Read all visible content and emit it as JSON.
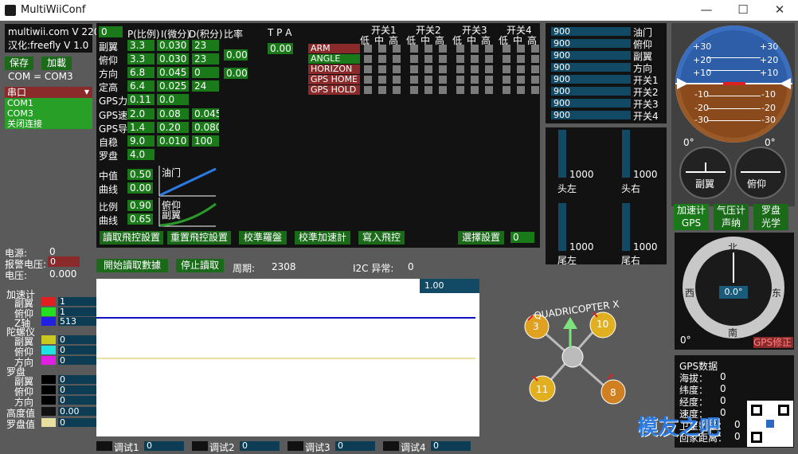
{
  "window": {
    "title": "MultiWiiConf",
    "min": "—",
    "max": "☐",
    "close": "✕"
  },
  "info": {
    "line1": "multiwii.com V 220",
    "line2": "汉化:freefly V 1.0"
  },
  "buttons": {
    "save": "保存",
    "load": "加載",
    "com_status": "COM = COM3",
    "read_pid": "讀取飛控設置",
    "reset_pid": "重置飛控設置",
    "calib_mag": "校準羅盤",
    "calib_acc": "校準加速計",
    "write": "寫入飛控",
    "select": "選擇設置",
    "select_val": "0",
    "start_read": "開始讀取數據",
    "stop_read": "停止讀取"
  },
  "serial": {
    "header": "串口",
    "items": [
      "COM1",
      "COM3",
      "关闭连接"
    ]
  },
  "pid": {
    "col0": "0",
    "header": [
      "P(比例)",
      "I(微分)",
      "D(积分)",
      "比率",
      "T P A"
    ],
    "rows": [
      {
        "name": "副翼",
        "p": "3.3",
        "i": "0.030",
        "d": "23"
      },
      {
        "name": "俯仰",
        "p": "3.3",
        "i": "0.030",
        "d": "23"
      },
      {
        "name": "方向",
        "p": "6.8",
        "i": "0.045",
        "d": "0"
      },
      {
        "name": "定高",
        "p": "6.4",
        "i": "0.025",
        "d": "24"
      },
      {
        "name": "GPS力",
        "p": "0.11",
        "i": "0.0",
        "d": ""
      },
      {
        "name": "GPS速",
        "p": "2.0",
        "i": "0.08",
        "d": "0.045"
      },
      {
        "name": "GPS导",
        "p": "1.4",
        "i": "0.20",
        "d": "0.080"
      },
      {
        "name": "自稳",
        "p": "9.0",
        "i": "0.010",
        "d": "100"
      },
      {
        "name": "罗盘",
        "p": "4.0",
        "i": "",
        "d": ""
      }
    ],
    "rate1": "0.00",
    "rate2": "0.00",
    "tpa": "0.00",
    "mid_label": "中值",
    "mid": "0.50",
    "curve_label": "曲线",
    "curve": "0.00",
    "throttle": "油门",
    "ratio_label": "比例",
    "ratio": "0.90",
    "curve2_label": "曲线",
    "curve2": "0.65",
    "pitchroll": "俯仰",
    "roll": "副翼"
  },
  "switches": {
    "groups": [
      "开关1",
      "开关2",
      "开关3",
      "开关4"
    ],
    "levels": [
      "低",
      "中",
      "高"
    ],
    "modes": [
      "ARM",
      "ANGLE",
      "HORIZON",
      "GPS HOME",
      "GPS HOLD"
    ]
  },
  "rc": {
    "items": [
      {
        "v": "900",
        "n": "油门"
      },
      {
        "v": "900",
        "n": "俯仰"
      },
      {
        "v": "900",
        "n": "副翼"
      },
      {
        "v": "900",
        "n": "方向"
      },
      {
        "v": "900",
        "n": "开关1"
      },
      {
        "v": "900",
        "n": "开关2"
      },
      {
        "v": "900",
        "n": "开关3"
      },
      {
        "v": "900",
        "n": "开关4"
      }
    ]
  },
  "motors": {
    "fl": "1000",
    "fr": "1000",
    "rl": "1000",
    "rr": "1000",
    "fl_n": "头左",
    "fr_n": "头右",
    "rl_n": "尾左",
    "rr_n": "尾右"
  },
  "horizon": {
    "ticks": [
      "+30",
      "+20",
      "+10",
      "-10",
      "-20",
      "-30"
    ],
    "deg_l": "0°",
    "deg_r": "0°",
    "roll": "副翼",
    "pitch": "俯仰"
  },
  "sensors": {
    "acc": "加速计",
    "baro": "气压计",
    "mag": "罗盘",
    "gps": "GPS",
    "sonar": "声纳",
    "opt": "光学"
  },
  "compass": {
    "n": "北",
    "s": "南",
    "w": "西",
    "e": "东",
    "val": "0.0°",
    "deg": "0°",
    "fix": "GPS修正"
  },
  "gps": {
    "title": "GPS数据",
    "alt": "海拔：",
    "lat": "纬度：",
    "lon": "经度：",
    "spd": "速度：",
    "sat": "卫星数量：",
    "dist": "回家距离：",
    "v": "0"
  },
  "power": {
    "v": "电源:",
    "vv": "0",
    "alarm": "报警电压:",
    "av": "0",
    "volt": "电压:",
    "vt": "0.000"
  },
  "status": {
    "cycle_l": "周期:",
    "cycle": "2308",
    "i2c_l": "I2C 异常:",
    "i2c": "0"
  },
  "graph": {
    "scale": "1.00",
    "quad": "QUADRICOPTER X",
    "m3": "3",
    "m10": "10",
    "m11": "11",
    "m8": "8"
  },
  "legend": {
    "acc": "加速计",
    "acc_roll": "副翼",
    "acc_pitch": "俯仰",
    "acc_z": "Z轴",
    "gyro": "陀螺仪",
    "gy_roll": "副翼",
    "gy_pitch": "俯仰",
    "gy_yaw": "方向",
    "mag": "罗盘",
    "mg_roll": "副翼",
    "mg_pitch": "俯仰",
    "mg_yaw": "方向",
    "alt": "高度值",
    "head": "罗盘值",
    "v_acc_roll": "1",
    "v_acc_pitch": "1",
    "v_acc_z": "513",
    "v_gr": "0",
    "v_gp": "0",
    "v_gy": "0",
    "v_mr": "0",
    "v_mp": "0",
    "v_my": "0",
    "v_alt": "0.00",
    "v_head": "0"
  },
  "debug": {
    "d1": "调试1",
    "d2": "调试2",
    "d3": "调试3",
    "d4": "调试4",
    "v": "0"
  },
  "watermark": "模友之吧"
}
